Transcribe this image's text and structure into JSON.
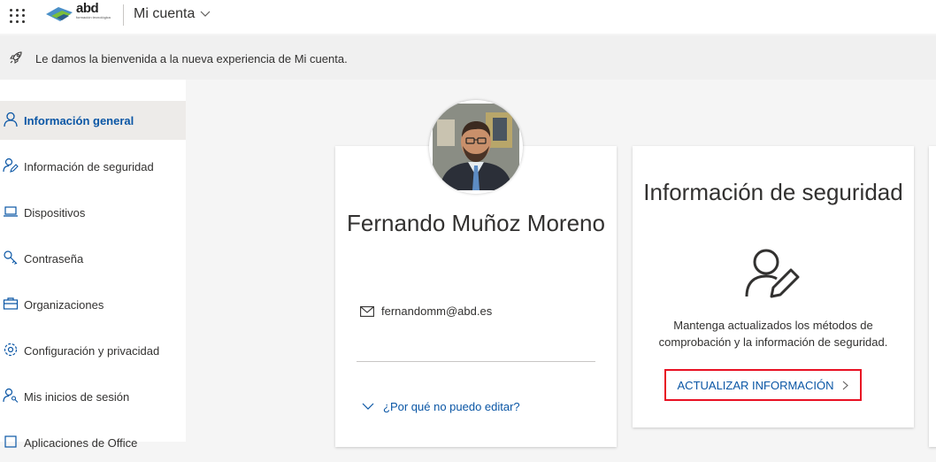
{
  "header": {
    "logo_text": "abd",
    "logo_subtitle": "formación tecnológica",
    "app_title": "Mi cuenta"
  },
  "banner": {
    "text": "Le damos la bienvenida a la nueva experiencia de Mi cuenta."
  },
  "sidebar": {
    "items": [
      {
        "label": "Información general",
        "active": true
      },
      {
        "label": "Información de seguridad"
      },
      {
        "label": "Dispositivos"
      },
      {
        "label": "Contraseña"
      },
      {
        "label": "Organizaciones"
      },
      {
        "label": "Configuración y privacidad"
      },
      {
        "label": "Mis inicios de sesión"
      },
      {
        "label": "Aplicaciones de Office"
      }
    ]
  },
  "profile": {
    "name": "Fernando Muñoz Moreno",
    "email": "fernandomm@abd.es",
    "why_cant_edit": "¿Por qué no puedo editar?"
  },
  "security": {
    "title": "Información de seguridad",
    "description": "Mantenga actualizados los métodos de comprobación y la información de seguridad.",
    "update_button": "ACTUALIZAR INFORMACIÓN"
  },
  "colors": {
    "accent": "#0a56a5",
    "highlight_border": "#e81123"
  }
}
